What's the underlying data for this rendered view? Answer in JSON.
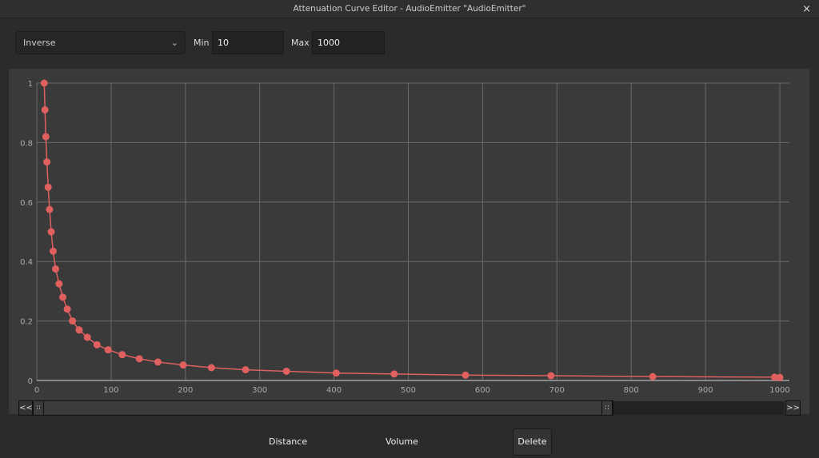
{
  "window": {
    "title": "Attenuation Curve Editor - AudioEmitter \"AudioEmitter\"",
    "close_icon": "×"
  },
  "toolbar": {
    "curve_type": "Inverse",
    "min_label": "Min",
    "min_value": "10",
    "max_label": "Max",
    "max_value": "1000"
  },
  "scroll": {
    "left_label": "<<",
    "right_label": ">>",
    "grip": "::"
  },
  "footer": {
    "distance_label": "Distance",
    "volume_label": "Volume",
    "delete_label": "Delete"
  },
  "chart_data": {
    "type": "line",
    "xlim": [
      0,
      1000
    ],
    "ylim": [
      0,
      1
    ],
    "x_ticks": [
      "0",
      "100",
      "200",
      "300",
      "400",
      "500",
      "600",
      "700",
      "800",
      "900",
      "1000"
    ],
    "y_ticks": [
      "0",
      "0.2",
      "0.4",
      "0.6",
      "0.8",
      "1"
    ],
    "grid": true,
    "color": "#e06060",
    "x": [
      10,
      11,
      12.2,
      13.6,
      15.3,
      17.2,
      19.4,
      22,
      25.3,
      30,
      35,
      41,
      48,
      57,
      68,
      81,
      96,
      115,
      138,
      163,
      197,
      235,
      281,
      336,
      403,
      481,
      577,
      692,
      829,
      993,
      1000
    ],
    "y": [
      1,
      0.91,
      0.82,
      0.735,
      0.65,
      0.575,
      0.5,
      0.435,
      0.375,
      0.325,
      0.28,
      0.24,
      0.2,
      0.17,
      0.145,
      0.12,
      0.103,
      0.087,
      0.073,
      0.062,
      0.052,
      0.043,
      0.036,
      0.031,
      0.025,
      0.022,
      0.018,
      0.016,
      0.013,
      0.011,
      0.01
    ]
  }
}
